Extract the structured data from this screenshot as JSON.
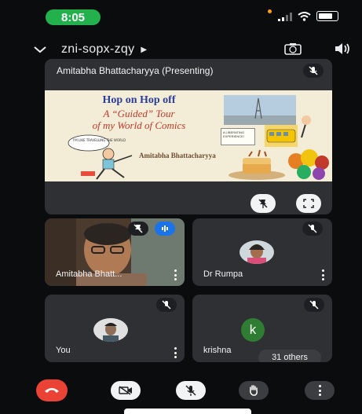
{
  "status_bar": {
    "time": "8:05"
  },
  "header": {
    "meeting_code": "zni-sopx-zqy"
  },
  "presenter": {
    "title": "Amitabha Bhattacharyya (Presenting)"
  },
  "slide": {
    "title_line1": "Hop on Hop off",
    "title_line2": "A “Guided” Tour",
    "title_line3": "of my World of Comics",
    "author": "Amitabha Bhattacharyya",
    "bubble_left": "I'M LIKE TRAVELLING THE WORLD",
    "bubble_right": "A LIBERATING EXPERIENCE!"
  },
  "participants": [
    {
      "name": "Amitabha Bhatt...",
      "muted": true,
      "speaking": true
    },
    {
      "name": "Dr Rumpa",
      "muted": true
    },
    {
      "name": "You",
      "muted": true
    },
    {
      "name": "krishna",
      "initial": "k",
      "muted": true,
      "others": "31 others"
    }
  ],
  "colors": {
    "status_green": "#22b14c",
    "tile_bg": "#2f3033",
    "end_call_red": "#ea4335",
    "speaking_blue": "#1a73e8",
    "krishna_avatar": "#2f7d32"
  },
  "icons": {
    "back": "chevron-down-icon",
    "camera_switch": "camera-switch-icon",
    "speaker": "speaker-icon",
    "mic_off": "mic-off-icon",
    "pin_off": "pin-off-icon",
    "fullscreen": "fullscreen-icon",
    "end_call": "end-call-icon",
    "video_off": "video-off-icon",
    "raise_hand": "hand-icon",
    "more": "more-vert-icon"
  }
}
